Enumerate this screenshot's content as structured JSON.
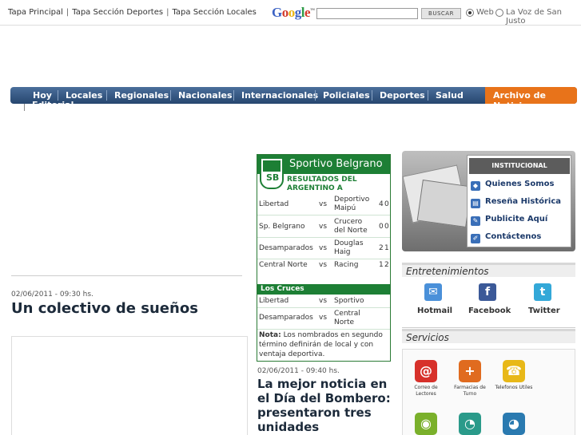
{
  "top_links": [
    "Tapa Principal",
    "Tapa Sección Deportes",
    "Tapa Sección Locales"
  ],
  "search": {
    "logo": "Google",
    "logo_tm": "™",
    "button": "BUSCAR",
    "option_web": "Web",
    "option_site": "La Voz de San Justo"
  },
  "nav": {
    "items": [
      "Hoy",
      "Locales",
      "Regionales",
      "Nacionales",
      "Internacionales",
      "Policiales",
      "Deportes",
      "Salud"
    ],
    "archive": "Archivo de Noticias",
    "editorial": "Editorial"
  },
  "article1": {
    "date": "02/06/2011 - 09:30 hs.",
    "headline": "Un colectivo de sueños"
  },
  "sports": {
    "crest_letters": "SB",
    "title": "Sportivo Belgrano",
    "subtitle": "RESULTADOS DEL ARGENTINO A",
    "matches": [
      {
        "home": "Libertad",
        "vs": "vs",
        "away": "Deportivo Maipú",
        "s1": "4",
        "s2": "0"
      },
      {
        "home": "Sp. Belgrano",
        "vs": "vs",
        "away": "Crucero del Norte",
        "s1": "0",
        "s2": "0"
      },
      {
        "home": "Desamparados",
        "vs": "vs",
        "away": "Douglas Haig",
        "s1": "2",
        "s2": "1"
      },
      {
        "home": "Central Norte",
        "vs": "vs",
        "away": "Racing",
        "s1": "1",
        "s2": "2"
      }
    ],
    "cruces_title": "Los Cruces",
    "cruces": [
      {
        "home": "Libertad",
        "vs": "vs",
        "away": "Sportivo"
      },
      {
        "home": "Desamparados",
        "vs": "vs",
        "away": "Central Norte"
      }
    ],
    "note_label": "Nota:",
    "note_text": "Los nombrados en segundo término definirán de local y con ventaja deportiva."
  },
  "article2": {
    "date": "02/06/2011 - 09:40 hs.",
    "headline": "La mejor noticia en el Día del Bombero: presentaron tres unidades"
  },
  "institucional": {
    "title": "INSTITUCIONAL",
    "items": [
      "Quienes Somos",
      "Reseña Histórica",
      "Publicite Aquí",
      "Contáctenos"
    ]
  },
  "entretenimientos": {
    "title": "Entretenimientos",
    "items": [
      {
        "label": "Hotmail",
        "icon": "hotmail-icon",
        "color": "#4a90d9"
      },
      {
        "label": "Facebook",
        "icon": "facebook-icon",
        "color": "#3b5998"
      },
      {
        "label": "Twitter",
        "icon": "twitter-icon",
        "color": "#33a8d8"
      }
    ]
  },
  "servicios": {
    "title": "Servicios",
    "items": [
      {
        "label": "Correo de Lectores",
        "glyph": "@",
        "color": "#d7312b"
      },
      {
        "label": "Farmacias de Turno",
        "glyph": "+",
        "color": "#e06b1f"
      },
      {
        "label": "Telefonos Utiles",
        "glyph": "☎",
        "color": "#e8b818"
      }
    ],
    "row2": [
      {
        "glyph": "◉",
        "color": "#7ab02b"
      },
      {
        "glyph": "◔",
        "color": "#2a9a8a"
      },
      {
        "glyph": "◕",
        "color": "#2a7ab0"
      }
    ]
  }
}
